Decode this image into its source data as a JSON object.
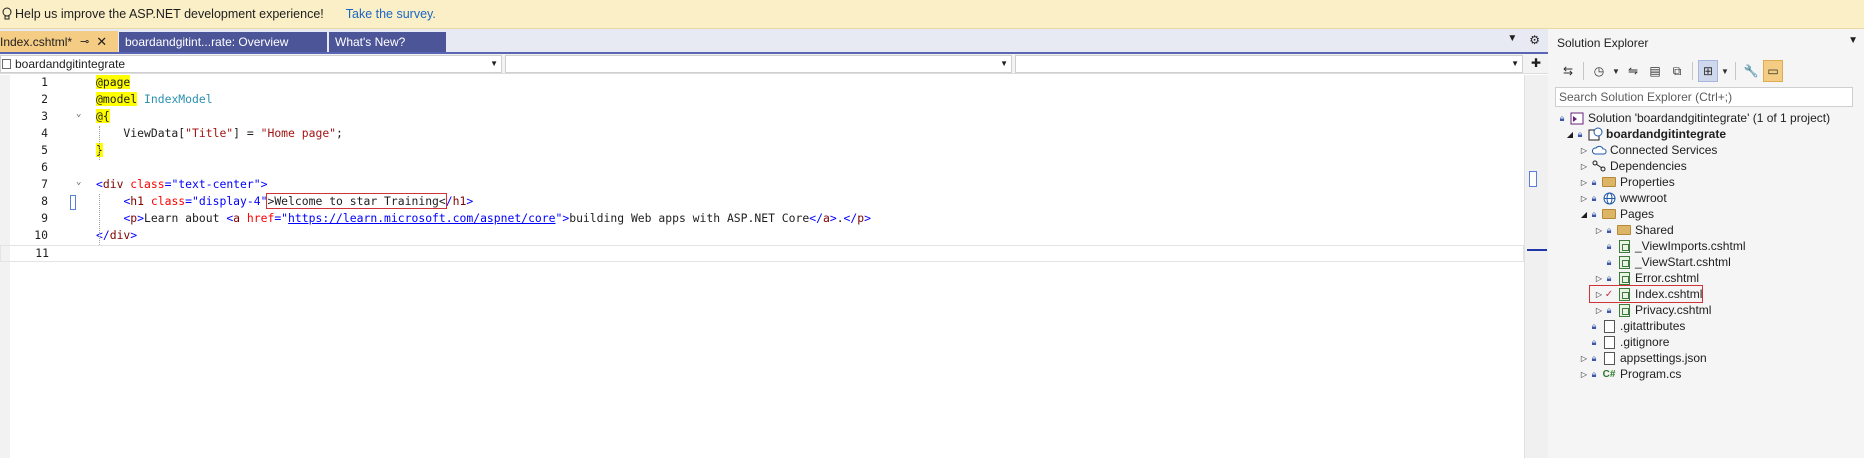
{
  "infobar": {
    "message": "Help us improve the ASP.NET development experience!",
    "link": "Take the survey."
  },
  "tabs": {
    "active": "Index.cshtml*",
    "tab2": "boardandgitint...rate: Overview",
    "tab3": "What's New?"
  },
  "navbar": {
    "project": "boardandgitintegrate",
    "member": "",
    "scope": ""
  },
  "code": {
    "lines": [
      {
        "n": "1",
        "parts": [
          [
            "razor",
            "@page"
          ]
        ]
      },
      {
        "n": "2",
        "parts": [
          [
            "razor",
            "@model"
          ],
          [
            "plain",
            " "
          ],
          [
            "type",
            "IndexModel"
          ]
        ]
      },
      {
        "n": "3",
        "parts": [
          [
            "razor",
            "@{"
          ]
        ]
      },
      {
        "n": "4",
        "parts": [
          [
            "plain",
            "    ViewData["
          ],
          [
            "str",
            "\"Title\""
          ],
          [
            "plain",
            "] = "
          ],
          [
            "str",
            "\"Home page\""
          ],
          [
            "plain",
            ";"
          ]
        ]
      },
      {
        "n": "5",
        "parts": [
          [
            "razor",
            "}"
          ]
        ]
      },
      {
        "n": "6",
        "parts": []
      },
      {
        "n": "7",
        "parts": [
          [
            "attrval",
            "<"
          ],
          [
            "tag",
            "div"
          ],
          [
            "plain",
            " "
          ],
          [
            "attr",
            "class"
          ],
          [
            "attrval",
            "=\"text-center\">"
          ]
        ]
      },
      {
        "n": "8",
        "parts": [
          [
            "plain",
            "    "
          ],
          [
            "attrval",
            "<"
          ],
          [
            "tag",
            "h1"
          ],
          [
            "plain",
            " "
          ],
          [
            "attr",
            "class"
          ],
          [
            "attrval",
            "=\"display-4\""
          ],
          [
            "box",
            ">Welcome to star Training<"
          ],
          [
            "attrval",
            "/"
          ],
          [
            "tag",
            "h1"
          ],
          [
            "attrval",
            ">"
          ]
        ]
      },
      {
        "n": "9",
        "parts": [
          [
            "plain",
            "    "
          ],
          [
            "attrval",
            "<"
          ],
          [
            "tag",
            "p"
          ],
          [
            "attrval",
            ">"
          ],
          [
            "plain",
            "Learn about "
          ],
          [
            "attrval",
            "<"
          ],
          [
            "tag",
            "a"
          ],
          [
            "plain",
            " "
          ],
          [
            "attr",
            "href"
          ],
          [
            "attrval",
            "=\""
          ],
          [
            "url",
            "https://learn.microsoft.com/aspnet/core"
          ],
          [
            "attrval",
            "\">"
          ],
          [
            "plain",
            "building Web apps with ASP.NET Core"
          ],
          [
            "attrval",
            "</"
          ],
          [
            "tag",
            "a"
          ],
          [
            "attrval",
            ">"
          ],
          [
            "plain",
            "."
          ],
          [
            "attrval",
            "</"
          ],
          [
            "tag",
            "p"
          ],
          [
            "attrval",
            ">"
          ]
        ]
      },
      {
        "n": "10",
        "parts": [
          [
            "attrval",
            "</"
          ],
          [
            "tag",
            "div"
          ],
          [
            "attrval",
            ">"
          ]
        ]
      },
      {
        "n": "11",
        "parts": []
      }
    ]
  },
  "solution_explorer": {
    "title": "Solution Explorer",
    "search_placeholder": "Search Solution Explorer (Ctrl+;)",
    "nodes": [
      {
        "label": "Solution 'boardandgitintegrate' (1 of 1 project)",
        "icon": "solution-icon"
      },
      {
        "label": "boardandgitintegrate",
        "icon": "web-project-icon"
      },
      {
        "label": "Connected Services",
        "icon": "cloud-icon"
      },
      {
        "label": "Dependencies",
        "icon": "dependencies-icon"
      },
      {
        "label": "Properties",
        "icon": "properties-folder-icon"
      },
      {
        "label": "wwwroot",
        "icon": "globe-icon"
      },
      {
        "label": "Pages",
        "icon": "folder-icon"
      },
      {
        "label": "Shared",
        "icon": "folder-icon"
      },
      {
        "label": "_ViewImports.cshtml",
        "icon": "cshtml-file-icon"
      },
      {
        "label": "_ViewStart.cshtml",
        "icon": "cshtml-file-icon"
      },
      {
        "label": "Error.cshtml",
        "icon": "cshtml-file-icon"
      },
      {
        "label": "Index.cshtml",
        "icon": "cshtml-file-icon"
      },
      {
        "label": "Privacy.cshtml",
        "icon": "cshtml-file-icon"
      },
      {
        "label": ".gitattributes",
        "icon": "file-icon"
      },
      {
        "label": ".gitignore",
        "icon": "file-icon"
      },
      {
        "label": "appsettings.json",
        "icon": "json-file-icon"
      },
      {
        "label": "Program.cs",
        "icon": "csharp-file-icon"
      }
    ]
  },
  "colors": {
    "accent": "#5a65b6",
    "active_tab": "#f5cc84",
    "infobar": "#fbefc7",
    "highlight_box": "#d13438"
  }
}
